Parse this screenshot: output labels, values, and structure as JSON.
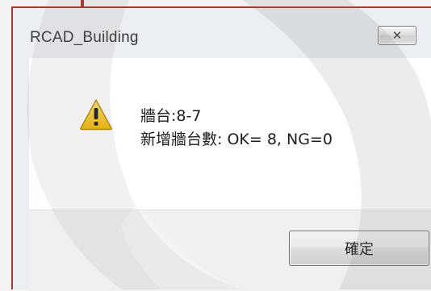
{
  "window": {
    "title": "RCAD_Building",
    "close_glyph": "✕"
  },
  "message": {
    "line1": "牆台:8-7",
    "line2": "新增牆台數: OK= 8, NG=0",
    "icon": "warning-icon"
  },
  "buttons": {
    "ok_label": "確定"
  },
  "colors": {
    "frame_accent": "#a9382c",
    "warning_yellow": "#f5c518"
  }
}
